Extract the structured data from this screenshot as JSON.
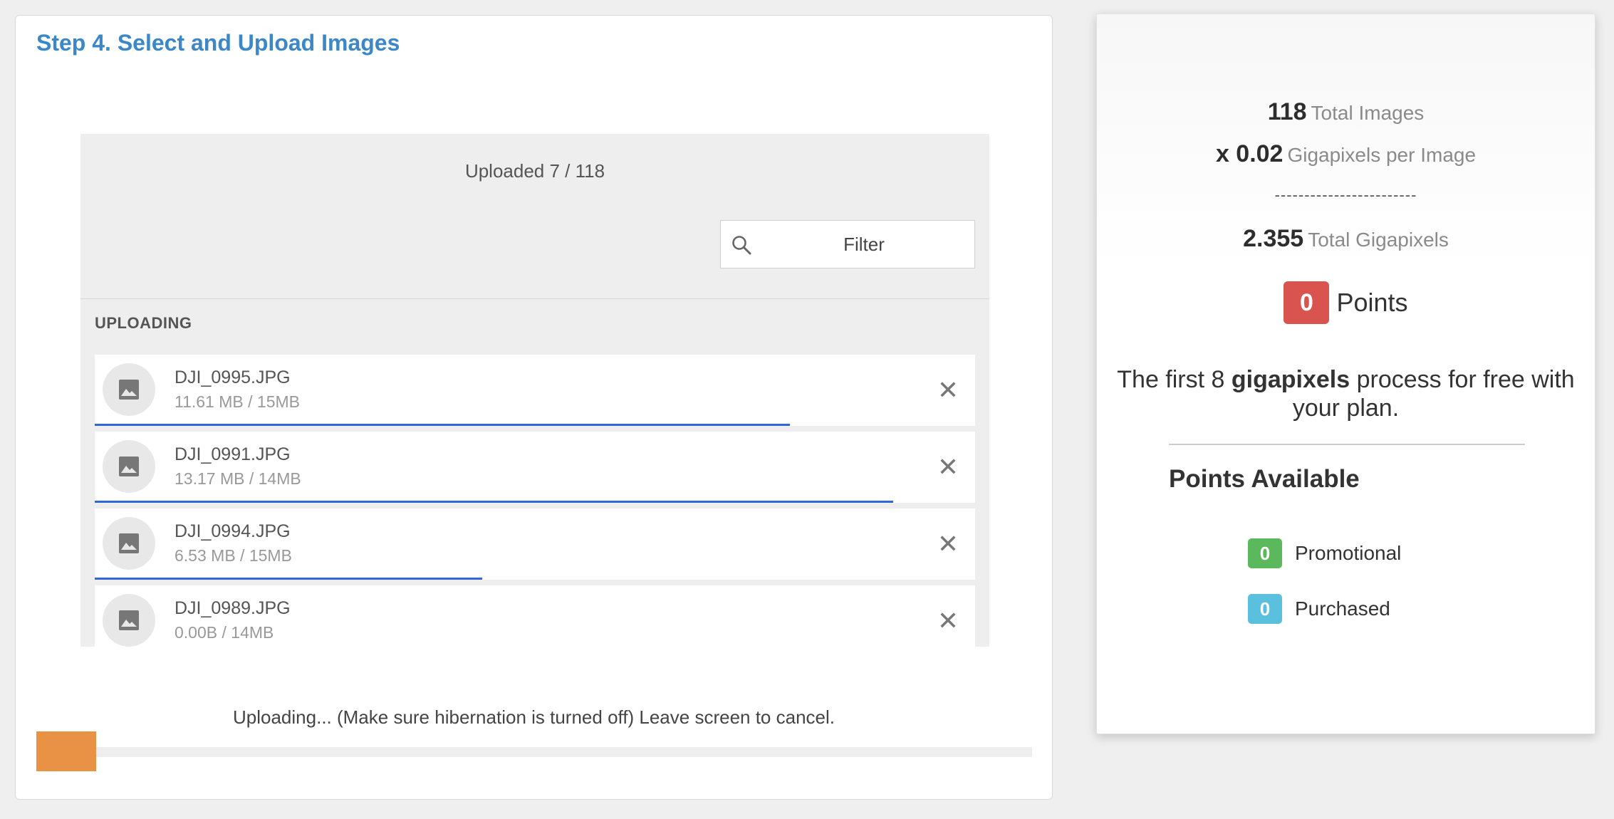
{
  "step": {
    "title": "Step 4. Select and Upload Images"
  },
  "uploader": {
    "uploaded_text": "Uploaded 7 / 118",
    "filter_placeholder": "Filter",
    "section_label": "UPLOADING",
    "files": [
      {
        "name": "DJI_0995.JPG",
        "size": "11.61 MB / 15MB",
        "progress": 0.79
      },
      {
        "name": "DJI_0991.JPG",
        "size": "13.17 MB / 14MB",
        "progress": 0.907
      },
      {
        "name": "DJI_0994.JPG",
        "size": "6.53 MB / 15MB",
        "progress": 0.44
      },
      {
        "name": "DJI_0989.JPG",
        "size": "0.00B / 14MB",
        "progress": 0
      }
    ],
    "status_text": "Uploading... (Make sure hibernation is turned off) Leave screen to cancel.",
    "overall_progress": 0.06,
    "icons": {
      "search": "search-icon",
      "file": "image-icon",
      "remove": "close-icon"
    }
  },
  "summary": {
    "total_images_value": "118",
    "total_images_label": "Total Images",
    "per_image_value": "x 0.02",
    "per_image_label": "Gigapixels per Image",
    "separator": "------------------------",
    "total_gp_value": "2.355",
    "total_gp_label": "Total Gigapixels",
    "points_value": "0",
    "points_label": "Points",
    "free_note_prefix": "The first 8 ",
    "free_note_bold": "gigapixels",
    "free_note_suffix": " process for free with your plan.",
    "points_available_title": "Points Available",
    "promotional_value": "0",
    "promotional_label": "Promotional",
    "purchased_value": "0",
    "purchased_label": "Purchased"
  },
  "colors": {
    "title_blue": "#3b87c8",
    "row_progress_blue": "#2f67d8",
    "overall_progress_orange": "#e99144",
    "points_red": "#d9534f",
    "promotional_green": "#5cb85c",
    "purchased_cyan": "#5bc0de"
  }
}
